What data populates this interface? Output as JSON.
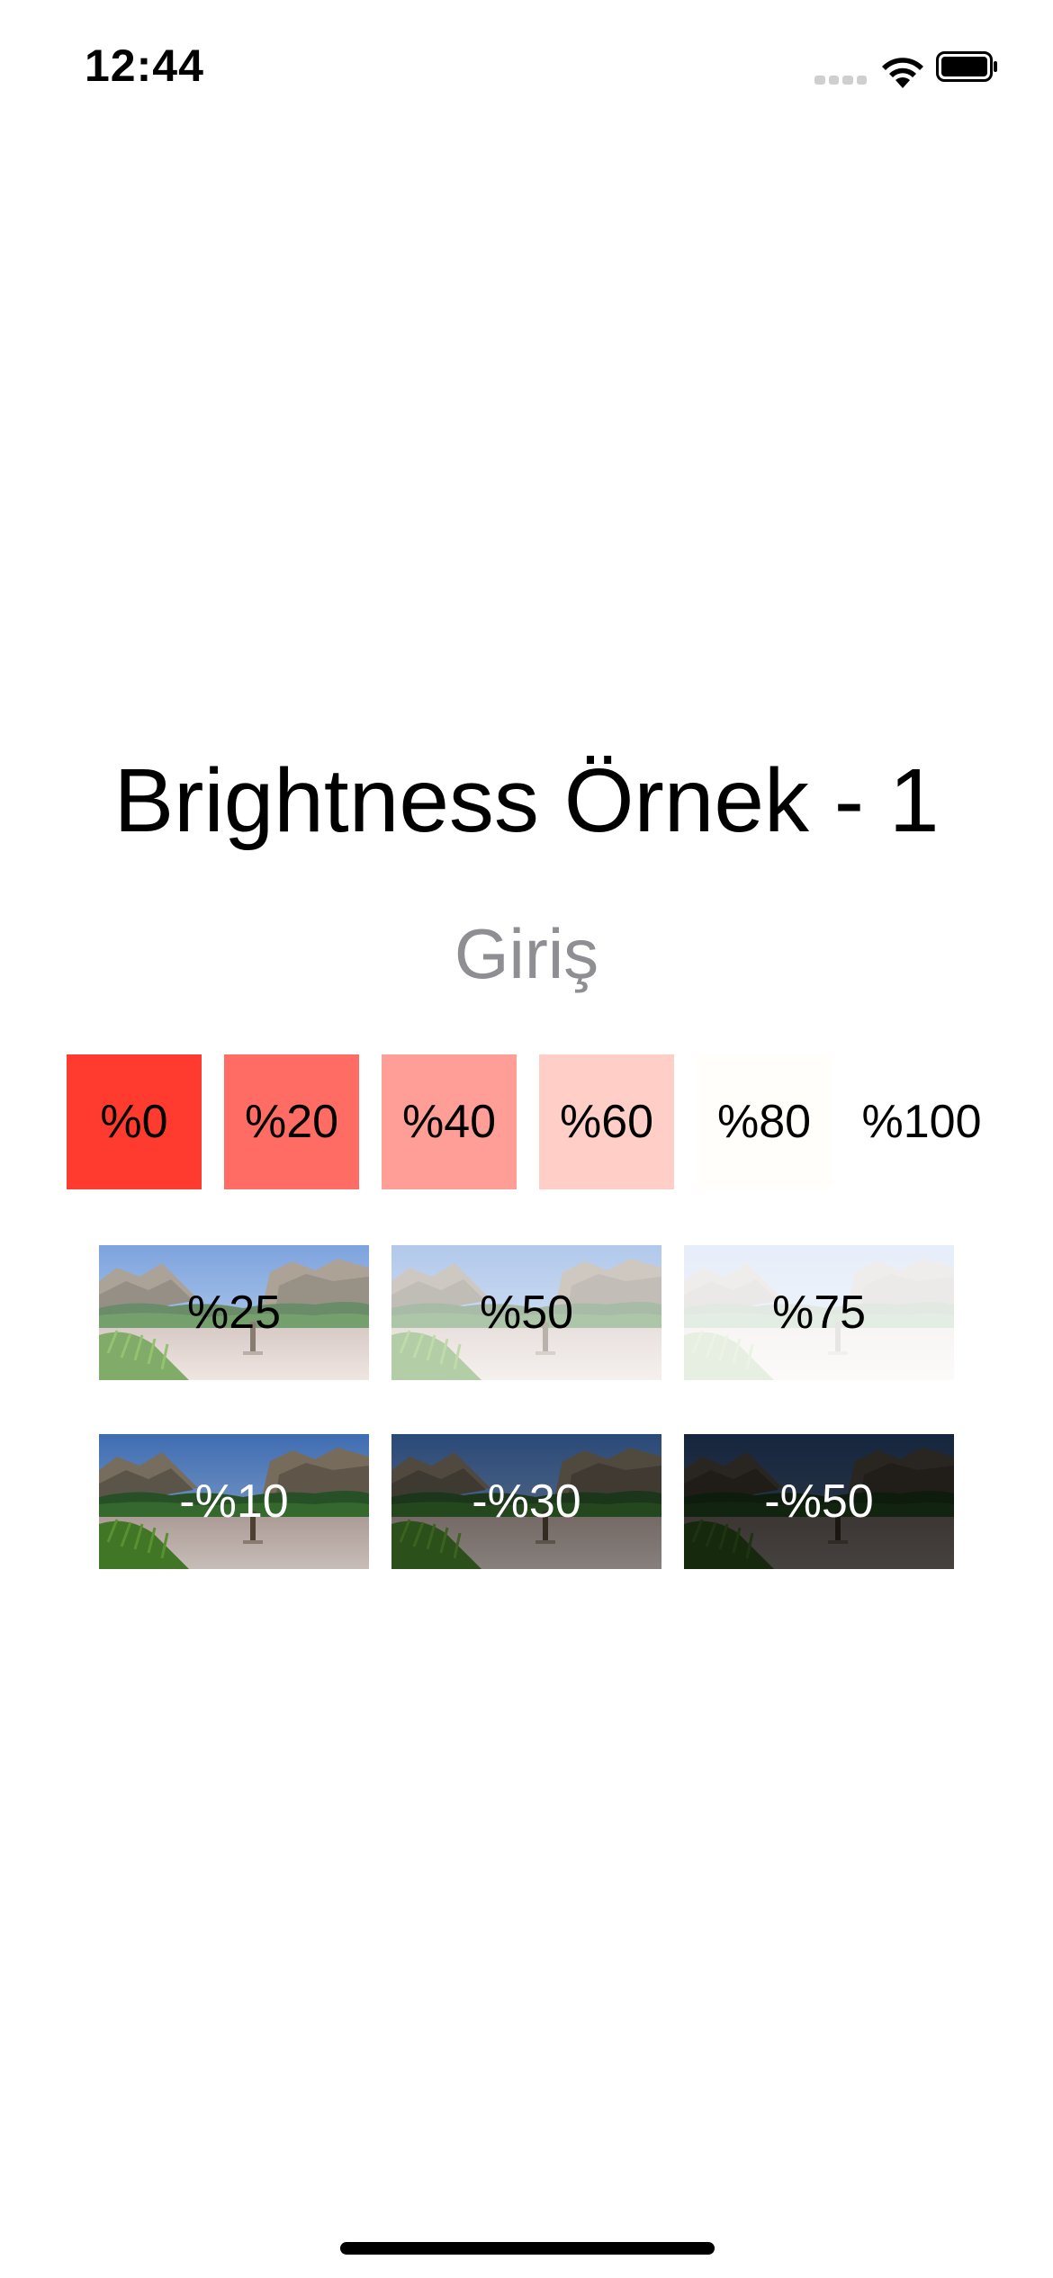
{
  "status_bar": {
    "time": "12:44"
  },
  "title": "Brightness Örnek - 1",
  "subtitle": "Giriş",
  "swatches": [
    {
      "label": "%0",
      "color": "#ff3b30"
    },
    {
      "label": "%20",
      "color": "#ff6c63"
    },
    {
      "label": "%40",
      "color": "#ff9d97"
    },
    {
      "label": "%60",
      "color": "#ffcfc7"
    },
    {
      "label": "%80",
      "color": "#fffefb"
    },
    {
      "label": "%100",
      "color": "#ffffff"
    }
  ],
  "brightened_images": [
    {
      "label": "%25",
      "brightness": 0.25
    },
    {
      "label": "%50",
      "brightness": 0.5
    },
    {
      "label": "%75",
      "brightness": 0.75
    }
  ],
  "darkened_images": [
    {
      "label": "-%10",
      "brightness": -0.1
    },
    {
      "label": "-%30",
      "brightness": -0.3
    },
    {
      "label": "-%50",
      "brightness": -0.5
    }
  ]
}
